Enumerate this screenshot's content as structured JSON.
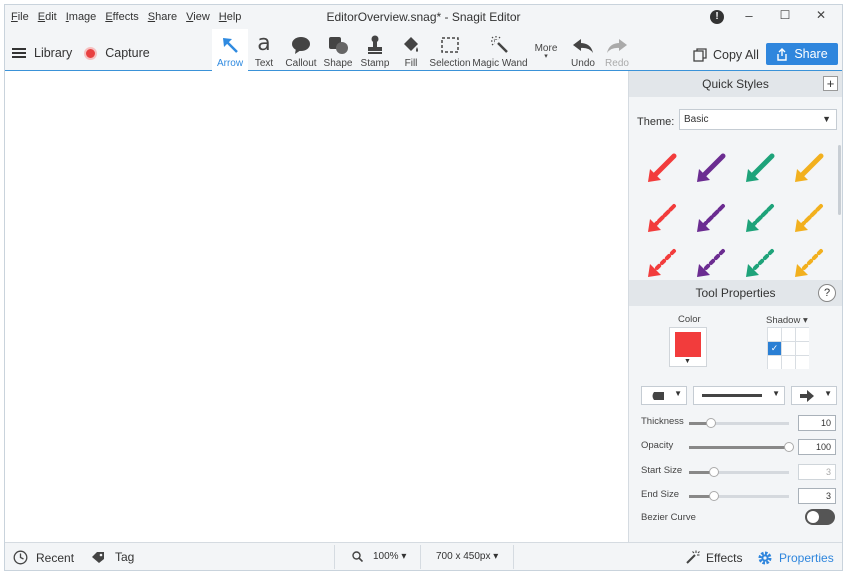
{
  "menu": [
    "File",
    "Edit",
    "Image",
    "Effects",
    "Share",
    "View",
    "Help"
  ],
  "window_title": "EditorOverview.snag* - Snagit Editor",
  "window_controls": {
    "minimize": "–",
    "maximize": "☐",
    "close": "✕"
  },
  "toolbar": {
    "library_label": "Library",
    "capture_label": "Capture",
    "tools": [
      {
        "label": "Arrow",
        "icon": "arrow-icon",
        "active": true
      },
      {
        "label": "Text",
        "icon": "text-icon"
      },
      {
        "label": "Callout",
        "icon": "callout-icon"
      },
      {
        "label": "Shape",
        "icon": "shape-icon"
      },
      {
        "label": "Stamp",
        "icon": "stamp-icon"
      },
      {
        "label": "Fill",
        "icon": "fill-icon"
      },
      {
        "label": "Selection",
        "icon": "selection-icon"
      },
      {
        "label": "Magic Wand",
        "icon": "magic-wand-icon"
      },
      {
        "label": "More",
        "icon": "more-icon"
      },
      {
        "label": "Undo",
        "icon": "undo-icon"
      },
      {
        "label": "Redo",
        "icon": "redo-icon",
        "disabled": true
      }
    ],
    "text_glyph": "a",
    "copy_all_label": "Copy All",
    "share_label": "Share"
  },
  "quick_styles": {
    "title": "Quick Styles",
    "add_symbol": "+",
    "theme_label": "Theme:",
    "theme_value": "Basic",
    "colors": [
      "#f23c3c",
      "#6b2c91",
      "#1ea37a",
      "#f2b01e"
    ]
  },
  "tool_properties": {
    "title": "Tool Properties",
    "help_symbol": "?",
    "color_label": "Color",
    "color_value": "#f23c3c",
    "shadow_label": "Shadow ▾",
    "sliders": [
      {
        "label": "Thickness",
        "value": "10",
        "level": 0.22
      },
      {
        "label": "Opacity",
        "value": "100",
        "level": 1.0
      },
      {
        "label": "Start Size",
        "value": "3",
        "level": 0.25,
        "dim": true
      },
      {
        "label": "End Size",
        "value": "3",
        "level": 0.25
      }
    ],
    "bezier_label": "Bezier Curve"
  },
  "status_bar": {
    "recent_label": "Recent",
    "tag_label": "Tag",
    "zoom_value": "100% ▾",
    "size_value": "700 x 450px ▾",
    "effects_label": "Effects",
    "properties_label": "Properties"
  }
}
